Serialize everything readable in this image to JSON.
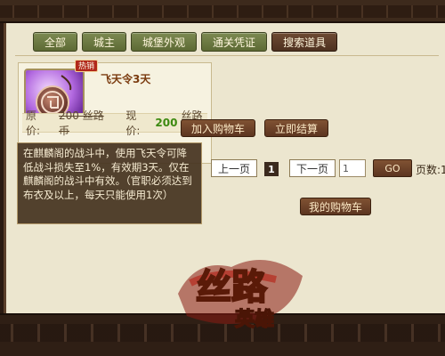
{
  "tabs": [
    {
      "label": "全部",
      "active": false
    },
    {
      "label": "城主",
      "active": false
    },
    {
      "label": "城堡外观",
      "active": false
    },
    {
      "label": "通关凭证",
      "active": false
    },
    {
      "label": "搜索道具",
      "active": true
    }
  ],
  "item": {
    "badge": "热销",
    "name": "飞天令3天",
    "original_price_label": "原价:",
    "original_price": "200 丝路币",
    "current_price_label": "现价:",
    "current_price": "200",
    "currency": "丝路币",
    "add_to_cart": "加入购物车",
    "checkout": "立即结算",
    "icon": "pendant-icon"
  },
  "tooltip": {
    "text": "在麒麟阁的战斗中，使用飞天令可降低战斗损失至1%，有效期3天。仅在麒麟阁的战斗中有效。（官职必须达到布衣及以上，每天只能使用1次）"
  },
  "pagination": {
    "prev": "上一页",
    "current_page": "1",
    "next": "下一页",
    "input_value": "1",
    "go": "GO",
    "total_label": "页数:1"
  },
  "my_cart": "我的购物车",
  "logo": {
    "text": "丝路英雄"
  },
  "colors": {
    "panel_bg": "#ece6cf",
    "tab_green": "#6e7b43",
    "tab_active": "#5a3a24",
    "price_green": "#3d8a11",
    "badge_red": "#b1281a"
  }
}
